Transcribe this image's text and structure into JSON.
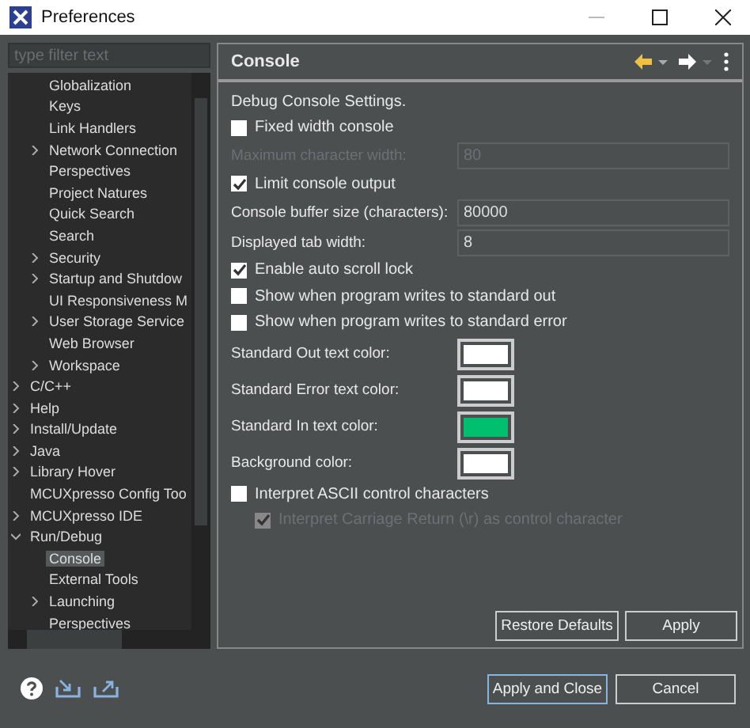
{
  "window": {
    "title": "Preferences"
  },
  "filter": {
    "placeholder": "type filter text"
  },
  "tree": {
    "items": [
      {
        "children": [
          {
            "label": "Globalization",
            "expandable": false,
            "selected": false
          },
          {
            "label": "Keys",
            "expandable": false,
            "selected": false
          },
          {
            "label": "Link Handlers",
            "expandable": false,
            "selected": false
          },
          {
            "label": "Network Connection",
            "expandable": true,
            "selected": false
          },
          {
            "label": "Perspectives",
            "expandable": false,
            "selected": false
          },
          {
            "label": "Project Natures",
            "expandable": false,
            "selected": false
          },
          {
            "label": "Quick Search",
            "expandable": false,
            "selected": false
          },
          {
            "label": "Search",
            "expandable": false,
            "selected": false
          },
          {
            "label": "Security",
            "expandable": true,
            "selected": false
          },
          {
            "label": "Startup and Shutdow",
            "expandable": true,
            "selected": false
          },
          {
            "label": "UI Responsiveness M",
            "expandable": false,
            "selected": false
          },
          {
            "label": "User Storage Service",
            "expandable": true,
            "selected": false
          },
          {
            "label": "Web Browser",
            "expandable": false,
            "selected": false
          },
          {
            "label": "Workspace",
            "expandable": true,
            "selected": false
          }
        ]
      },
      {
        "label": "C/C++",
        "expandable": true,
        "selected": false
      },
      {
        "label": "Help",
        "expandable": true,
        "selected": false
      },
      {
        "label": "Install/Update",
        "expandable": true,
        "selected": false
      },
      {
        "label": "Java",
        "expandable": true,
        "selected": false
      },
      {
        "label": "Library Hover",
        "expandable": true,
        "selected": false
      },
      {
        "label": "MCUXpresso Config Too",
        "expandable": false,
        "selected": false
      },
      {
        "label": "MCUXpresso IDE",
        "expandable": true,
        "selected": false
      },
      {
        "label": "Run/Debug",
        "expandable": true,
        "expanded": true,
        "selected": false,
        "children": [
          {
            "label": "Console",
            "expandable": false,
            "selected": true
          },
          {
            "label": "External Tools",
            "expandable": false,
            "selected": false
          },
          {
            "label": "Launching",
            "expandable": true,
            "selected": false
          },
          {
            "label": "Perspectives",
            "expandable": false,
            "selected": false
          }
        ]
      }
    ]
  },
  "page": {
    "title": "Console",
    "controls": [
      {
        "kind": "label",
        "label": "Debug Console Settings."
      },
      {
        "kind": "checkbox",
        "label": "Fixed width console",
        "checked": false,
        "disabled": false
      },
      {
        "kind": "field",
        "label": "Maximum character width:",
        "value": "80",
        "disabled": true
      },
      {
        "kind": "checkbox",
        "label": "Limit console output",
        "checked": true,
        "disabled": false
      },
      {
        "kind": "field",
        "label": "Console buffer size (characters):",
        "value": "80000",
        "disabled": false
      },
      {
        "kind": "field",
        "label": "Displayed tab width:",
        "value": "8",
        "disabled": false
      },
      {
        "kind": "checkbox",
        "label": "Enable auto scroll lock",
        "checked": true,
        "disabled": false
      },
      {
        "kind": "checkbox",
        "label": "Show when program writes to standard out",
        "checked": false,
        "disabled": false
      },
      {
        "kind": "checkbox",
        "label": "Show when program writes to standard error",
        "checked": false,
        "disabled": false
      },
      {
        "kind": "color",
        "label": "Standard Out text color:",
        "color": "#ffffff"
      },
      {
        "kind": "color",
        "label": "Standard Error text color:",
        "color": "#ffffff"
      },
      {
        "kind": "color",
        "label": "Standard In text color:",
        "color": "#00c070"
      },
      {
        "kind": "color",
        "label": "Background color:",
        "color": "#ffffff"
      },
      {
        "kind": "checkbox",
        "label": "Interpret ASCII control characters",
        "checked": false,
        "disabled": false,
        "children": [
          {
            "kind": "checkbox",
            "label": "Interpret Carriage Return (\\r) as control character",
            "checked": true,
            "disabled": true
          }
        ]
      }
    ],
    "buttons": [
      "Restore Defaults",
      "Apply"
    ]
  },
  "footer": {
    "buttons": [
      {
        "label": "Apply and Close",
        "default": true
      },
      {
        "label": "Cancel",
        "default": false
      }
    ]
  }
}
